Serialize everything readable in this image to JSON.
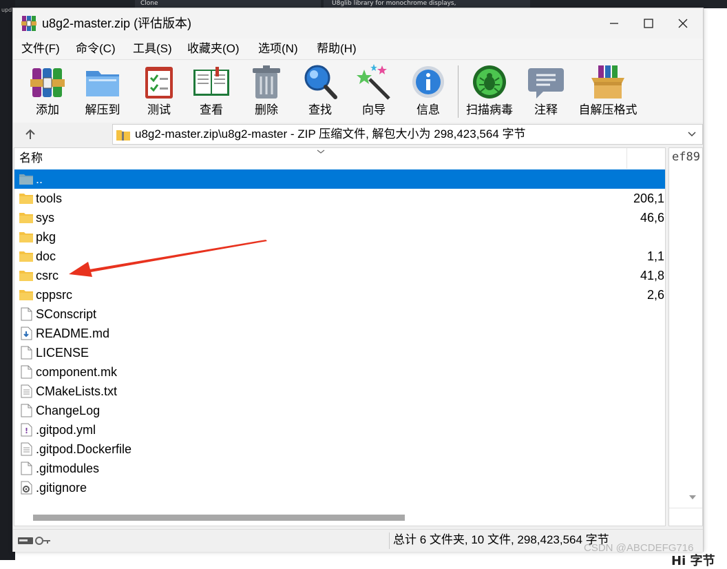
{
  "window": {
    "title": "u8g2-master.zip (评估版本)"
  },
  "background": {
    "tab_left": "Clone",
    "tab_right": "U8glib library for monochrome displays,",
    "left_text": "upd",
    "bottom_text": "Hi 字节",
    "watermark": "CSDN @ABCDEFG716"
  },
  "menu": [
    "文件(F)",
    "命令(C)",
    "工具(S)",
    "收藏夹(O)",
    "选项(N)",
    "帮助(H)"
  ],
  "toolbar": [
    {
      "label": "添加",
      "icon": "add-archive-icon"
    },
    {
      "label": "解压到",
      "icon": "extract-to-icon"
    },
    {
      "label": "测试",
      "icon": "test-icon"
    },
    {
      "label": "查看",
      "icon": "view-icon"
    },
    {
      "label": "删除",
      "icon": "delete-icon"
    },
    {
      "label": "查找",
      "icon": "find-icon"
    },
    {
      "label": "向导",
      "icon": "wizard-icon"
    },
    {
      "label": "信息",
      "icon": "info-icon"
    },
    {
      "label": "扫描病毒",
      "icon": "virus-scan-icon"
    },
    {
      "label": "注释",
      "icon": "comment-icon"
    },
    {
      "label": "自解压格式",
      "icon": "sfx-icon"
    }
  ],
  "address": {
    "path": "u8g2-master.zip\\u8g2-master - ZIP 压缩文件, 解包大小为 298,423,564 字节"
  },
  "columns": {
    "name": "名称"
  },
  "files": [
    {
      "name": "..",
      "size": "",
      "type": "parent",
      "selected": true
    },
    {
      "name": "tools",
      "size": "206,1",
      "type": "folder"
    },
    {
      "name": "sys",
      "size": "46,6",
      "type": "folder"
    },
    {
      "name": "pkg",
      "size": "",
      "type": "folder"
    },
    {
      "name": "doc",
      "size": "1,1",
      "type": "folder"
    },
    {
      "name": "csrc",
      "size": "41,8",
      "type": "folder"
    },
    {
      "name": "cppsrc",
      "size": "2,6",
      "type": "folder"
    },
    {
      "name": "SConscript",
      "size": "",
      "type": "file"
    },
    {
      "name": "README.md",
      "size": "",
      "type": "markdown"
    },
    {
      "name": "LICENSE",
      "size": "",
      "type": "file"
    },
    {
      "name": "component.mk",
      "size": "",
      "type": "file"
    },
    {
      "name": "CMakeLists.txt",
      "size": "",
      "type": "text"
    },
    {
      "name": "ChangeLog",
      "size": "",
      "type": "file"
    },
    {
      "name": ".gitpod.yml",
      "size": "",
      "type": "yml"
    },
    {
      "name": ".gitpod.Dockerfile",
      "size": "",
      "type": "text"
    },
    {
      "name": ".gitmodules",
      "size": "",
      "type": "file"
    },
    {
      "name": ".gitignore",
      "size": "",
      "type": "config"
    }
  ],
  "side_panel": {
    "text": "ef89"
  },
  "status": {
    "summary": "总计 6 文件夹, 10 文件, 298,423,564 字节"
  },
  "colors": {
    "selection": "#0078d7",
    "annotation_arrow": "#e8321e",
    "folder": "#f5c242"
  }
}
